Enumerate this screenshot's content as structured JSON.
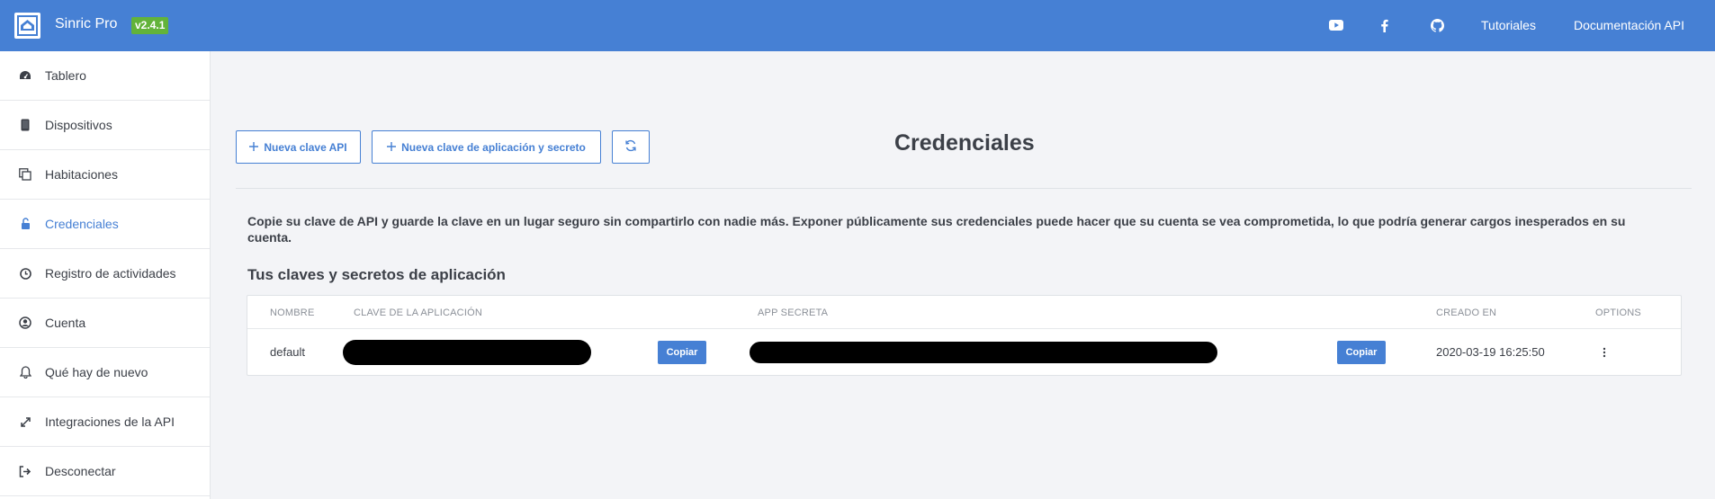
{
  "header": {
    "brand": "Sinric Pro",
    "version": "v2.4.1",
    "links": [
      "Tutoriales",
      "Documentación API"
    ],
    "icons": [
      "youtube-icon",
      "facebook-icon",
      "github-icon"
    ]
  },
  "sidebar": {
    "items": [
      {
        "label": "Tablero",
        "icon": "dashboard-icon"
      },
      {
        "label": "Dispositivos",
        "icon": "device-icon"
      },
      {
        "label": "Habitaciones",
        "icon": "rooms-icon"
      },
      {
        "label": "Credenciales",
        "icon": "unlock-icon",
        "active": true
      },
      {
        "label": "Registro de actividades",
        "icon": "clock-icon"
      },
      {
        "label": "Cuenta",
        "icon": "user-circle-icon"
      },
      {
        "label": "Qué hay de nuevo",
        "icon": "bell-icon"
      },
      {
        "label": "Integraciones de la API",
        "icon": "expand-icon"
      },
      {
        "label": "Desconectar",
        "icon": "sign-out-icon"
      }
    ]
  },
  "toolbar": {
    "new_api_key": "Nueva clave API",
    "new_app_key": "Nueva clave de aplicación y secreto",
    "refresh_icon": "refresh-icon"
  },
  "main": {
    "title": "Credenciales",
    "notice": "Copie su clave de API y guarde la clave en un lugar seguro sin compartirlo con nadie más. Exponer públicamente sus credenciales puede hacer que su cuenta se vea comprometida, lo que podría generar cargos inesperados en su cuenta.",
    "section_title": "Tus claves y secretos de aplicación"
  },
  "table": {
    "headers": [
      "NOMBRE",
      "CLAVE DE LA APLICACIÓN",
      "APP SECRETA",
      "CREADO EN",
      "OPTIONS"
    ],
    "rows": [
      {
        "name": "default",
        "copy_key": "Copiar",
        "copy_secret": "Copiar",
        "created": "2020-03-19 16:25:50"
      }
    ]
  },
  "colors": {
    "primary": "#4680d4",
    "badge": "#62b33a",
    "background": "#f3f4f7"
  }
}
